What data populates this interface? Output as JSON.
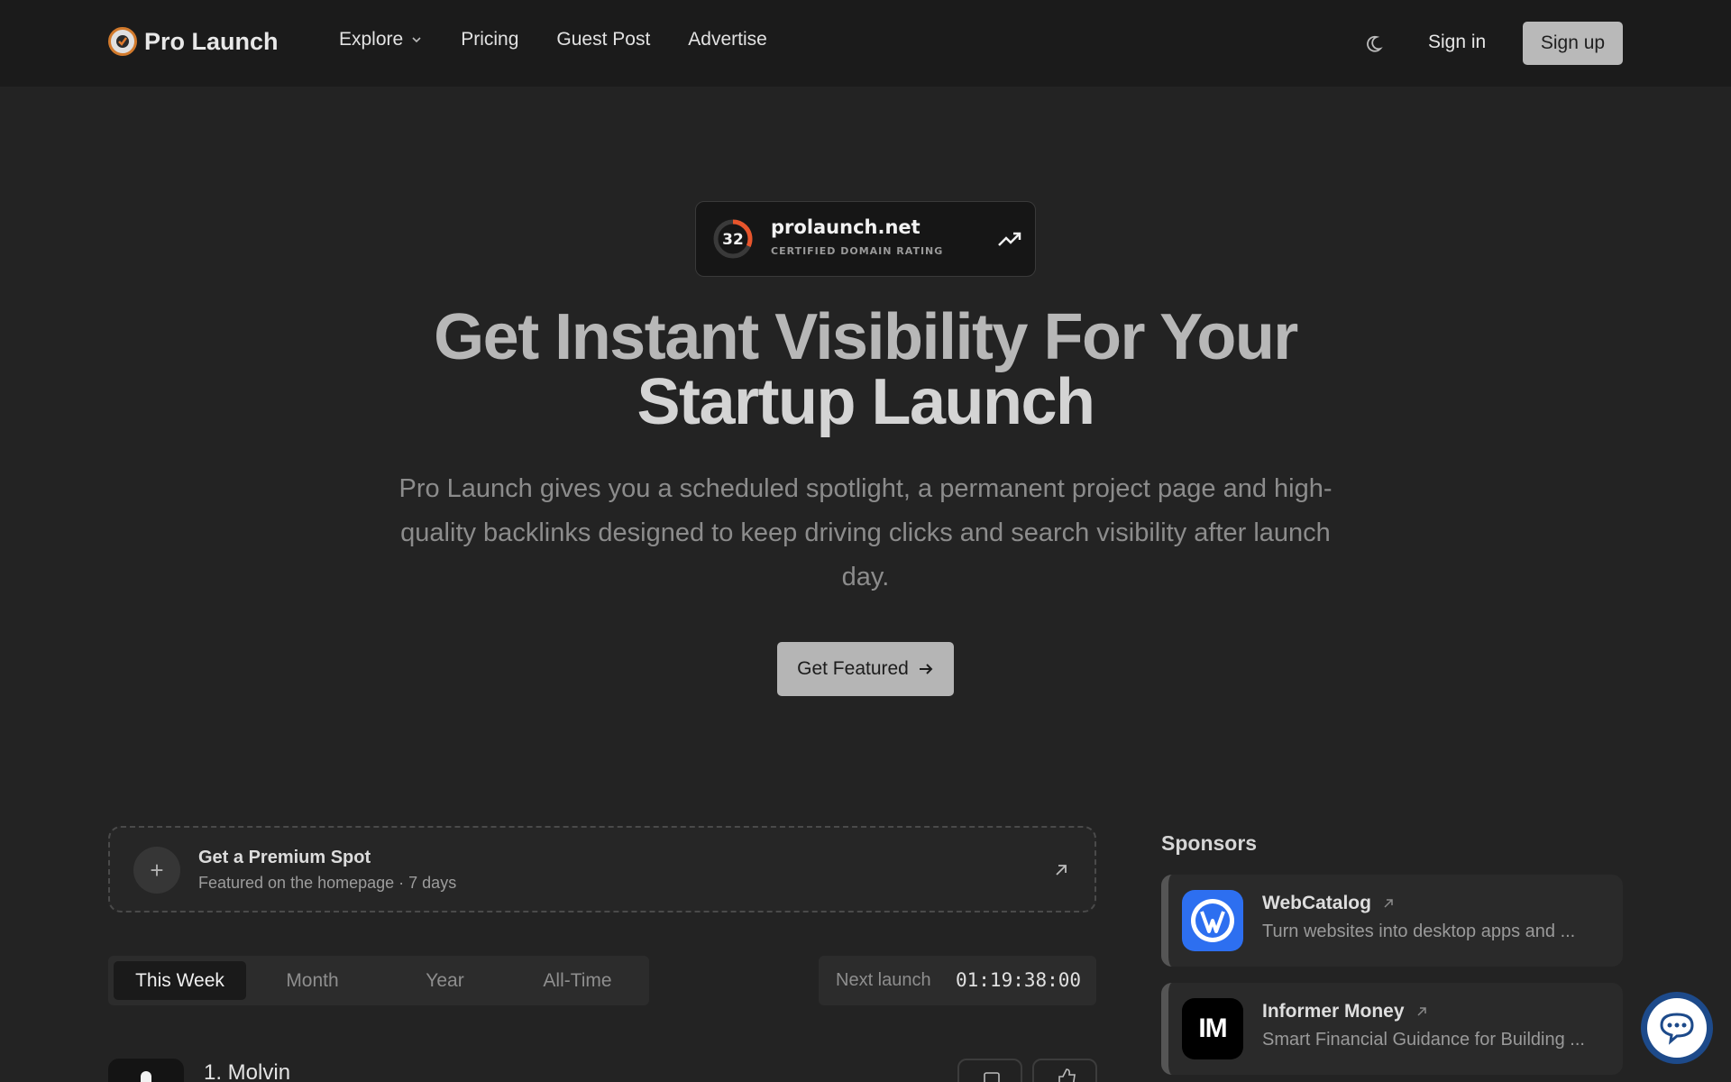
{
  "header": {
    "brand": "Pro Launch",
    "nav": [
      {
        "label": "Explore",
        "has_dropdown": true
      },
      {
        "label": "Pricing"
      },
      {
        "label": "Guest Post"
      },
      {
        "label": "Advertise"
      }
    ],
    "theme_icon": "moon-icon",
    "signin_label": "Sign in",
    "signup_label": "Sign up"
  },
  "rating_card": {
    "score": "32",
    "domain": "prolaunch.net",
    "caption": "CERTIFIED DOMAIN RATING",
    "trend_icon": "trending-up-icon"
  },
  "hero": {
    "title_line1": "Get Instant Visibility For Your",
    "title_line2": "Startup Launch",
    "subtitle": "Pro Launch gives you a scheduled spotlight, a permanent project page and high-quality backlinks designed to keep driving clicks and search visibility after launch day.",
    "cta_label": "Get Featured"
  },
  "premium": {
    "title": "Get a Premium Spot",
    "subtitle": "Featured on the homepage · 7 days"
  },
  "tabs": [
    {
      "label": "This Week",
      "active": true
    },
    {
      "label": "Month",
      "active": false
    },
    {
      "label": "Year",
      "active": false
    },
    {
      "label": "All-Time",
      "active": false
    }
  ],
  "next_launch": {
    "label": "Next launch",
    "timer": "01:19:38:00"
  },
  "products": [
    {
      "name": "1. Molvin"
    }
  ],
  "sponsors": {
    "title": "Sponsors",
    "items": [
      {
        "name": "WebCatalog",
        "description": "Turn websites into desktop apps and ...",
        "logo_color": "#2d6ff0"
      },
      {
        "name": "Informer Money",
        "description": "Smart Financial Guidance for Building ...",
        "logo_text": "IM",
        "logo_color": "#000000"
      }
    ]
  },
  "colors": {
    "background": "#232323",
    "header": "#1b1b1b",
    "rating_accent": "#e8552c",
    "logo_ring": "#d27a2c"
  }
}
